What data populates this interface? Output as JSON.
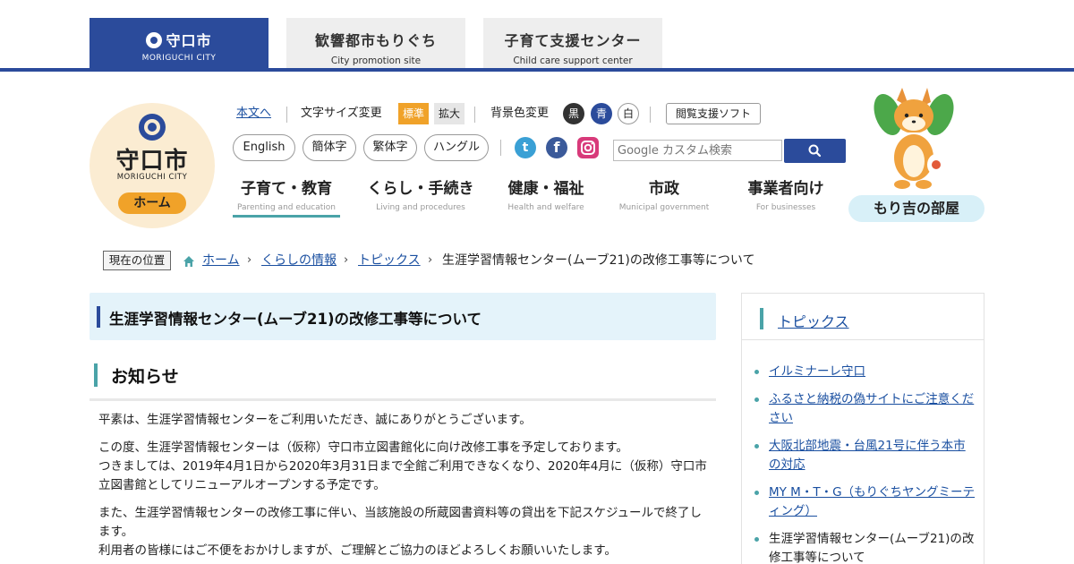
{
  "top_tabs": [
    {
      "title": "守口市",
      "subtitle": "MORIGUCHI CITY"
    },
    {
      "title": "歓響都市もりぐち",
      "subtitle": "City promotion site"
    },
    {
      "title": "子育て支援センター",
      "subtitle": "Child care support center"
    }
  ],
  "logo": {
    "name": "守口市",
    "en": "MORIGUCHI CITY",
    "home": "ホーム"
  },
  "utility": {
    "skip": "本文へ",
    "font_size_label": "文字サイズ変更",
    "size_standard": "標準",
    "size_large": "拡大",
    "bg_label": "背景色変更",
    "bg_black": "黒",
    "bg_blue": "青",
    "bg_white": "白",
    "reading_soft": "閲覧支援ソフト"
  },
  "languages": [
    "English",
    "簡体字",
    "繁体字",
    "ハングル"
  ],
  "sns": {
    "twitter": "t",
    "facebook": "f"
  },
  "search": {
    "placeholder": "Google カスタム検索"
  },
  "nav": [
    {
      "ja": "子育て・教育",
      "en": "Parenting and education"
    },
    {
      "ja": "くらし・手続き",
      "en": "Living and procedures"
    },
    {
      "ja": "健康・福祉",
      "en": "Health and welfare"
    },
    {
      "ja": "市政",
      "en": "Municipal government"
    },
    {
      "ja": "事業者向け",
      "en": "For businesses"
    }
  ],
  "mascot": {
    "label": "もり吉の部屋"
  },
  "breadcrumb": {
    "badge": "現在の位置",
    "items": [
      "ホーム",
      "くらしの情報",
      "トピックス"
    ],
    "current": "生涯学習情報センター(ムーブ21)の改修工事等について"
  },
  "page": {
    "title": "生涯学習情報センター(ムーブ21)の改修工事等について",
    "section": "お知らせ",
    "paragraphs": [
      "平素は、生涯学習情報センターをご利用いただき、誠にありがとうございます。",
      "この度、生涯学習情報センターは（仮称）守口市立図書館化に向け改修工事を予定しております。",
      "つきましては、2019年4月1日から2020年3月31日まで全館ご利用できなくなり、2020年4月に（仮称）守口市立図書館としてリニューアルオープンする予定です。",
      "また、生涯学習情報センターの改修工事に伴い、当該施設の所蔵図書資料等の貸出を下記スケジュールで終了します。",
      "利用者の皆様にはご不便をおかけしますが、ご理解とご協力のほどよろしくお願いいたします。"
    ]
  },
  "sidebar": {
    "heading": "トピックス",
    "items": [
      "イルミナーレ守口",
      "ふるさと納税の偽サイトにご注意ください",
      "大阪北部地震・台風21号に伴う本市の対応",
      "MY M・T・G（もりぐちヤングミーティング）",
      "生涯学習情報センター(ムーブ21)の改修工事等について"
    ]
  },
  "colors": {
    "brand": "#2b4b9b",
    "accent": "#4aa3a8",
    "orange": "#f0a229",
    "link": "#1a4fa0"
  }
}
